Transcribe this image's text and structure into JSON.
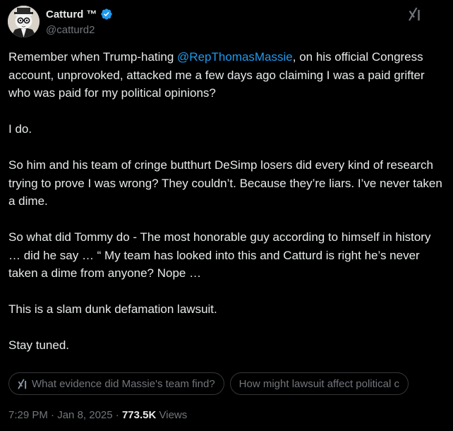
{
  "author": {
    "display_name": "Catturd ™",
    "handle": "@catturd2",
    "verified": true,
    "verified_color": "#1d9bf0"
  },
  "icons": {
    "platform_logo": "x-logo-icon",
    "verified": "verified-badge-icon",
    "grok": "grok-icon"
  },
  "tweet": {
    "paragraph_1": {
      "before": "Remember when Trump-hating ",
      "mention": "@RepThomasMassie",
      "after": ", on his official Congress account, unprovoked, attacked me a few days ago claiming I was a paid grifter who was paid for my political opinions?"
    },
    "paragraph_2": "I do.",
    "paragraph_3": "So him and his team of cringe butthurt DeSimp losers did every kind of research trying to prove I was wrong? They couldn’t. Because they’re liars. I’ve never taken a dime.",
    "paragraph_4": "So what did Tommy do - The most honorable guy according to himself in history … did he say … “ My team has looked into this and Catturd is right he’s never taken a dime from anyone? Nope …",
    "paragraph_5": "This is a slam dunk defamation lawsuit.",
    "paragraph_6": "Stay tuned."
  },
  "grok_prompts": [
    {
      "label": "What evidence did Massie's team find?"
    },
    {
      "label": "How might lawsuit affect political c"
    }
  ],
  "meta": {
    "time": "7:29 PM",
    "separator": " · ",
    "date": "Jan 8, 2025",
    "views_count": "773.5K",
    "views_label": " Views"
  },
  "colors": {
    "background": "#000000",
    "text": "#e7e9ea",
    "secondary_text": "#71767b",
    "link": "#1d9bf0",
    "chip_border": "#333639"
  }
}
